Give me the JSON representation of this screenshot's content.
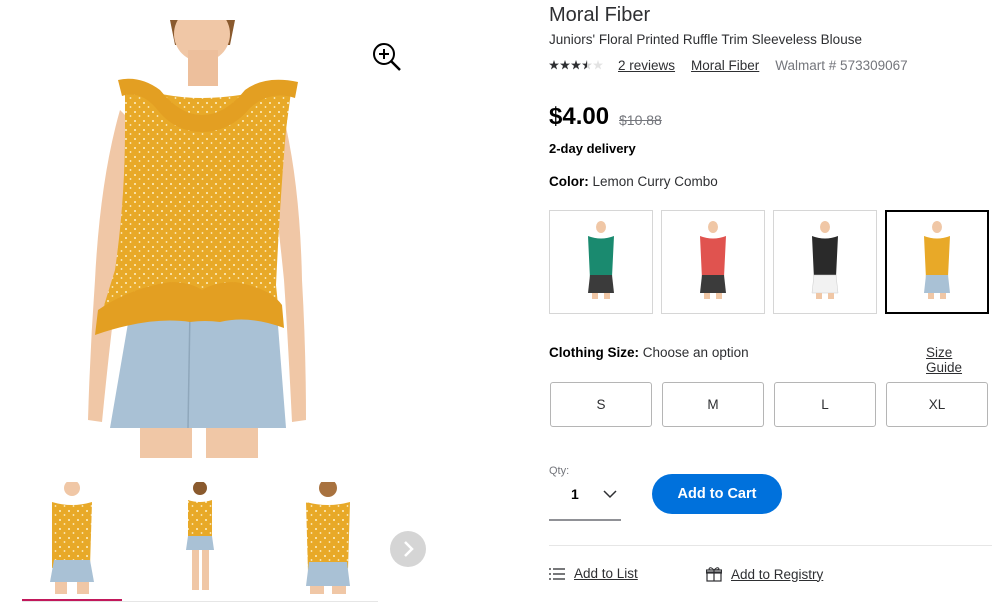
{
  "colors": {
    "accent": "#0071dc",
    "thumb_active_bar": "#c2185b",
    "swatch_teal": "#1a8a6f",
    "swatch_red": "#e0534f",
    "swatch_black": "#2a2a2a",
    "swatch_yellow": "#e8a928"
  },
  "product": {
    "brand": "Moral Fiber",
    "title": "Juniors' Floral Printed Ruffle Trim Sleeveless Blouse",
    "rating": 3.5,
    "reviews_link": "2 reviews",
    "brand_link": "Moral Fiber",
    "item_number": "Walmart # 573309067",
    "price": "$4.00",
    "was_price": "$10.88",
    "delivery": "2-day delivery"
  },
  "color_selector": {
    "label": "Color:",
    "selected_value": "Lemon Curry Combo",
    "swatches": [
      {
        "name": "teal"
      },
      {
        "name": "red"
      },
      {
        "name": "black"
      },
      {
        "name": "yellow",
        "selected": true
      }
    ]
  },
  "size_selector": {
    "label": "Clothing Size:",
    "value": "Choose an option",
    "guide_link": "Size Guide",
    "options": [
      "S",
      "M",
      "L",
      "XL"
    ]
  },
  "quantity": {
    "label": "Qty:",
    "value": "1"
  },
  "actions": {
    "add_to_cart": "Add to Cart",
    "add_to_list": "Add to List",
    "add_to_registry": "Add to Registry"
  },
  "icons": {
    "zoom": "zoom-in-icon",
    "next": "chevron-right-icon",
    "qty": "chevron-down-icon",
    "list": "list-icon",
    "registry": "gift-icon"
  }
}
